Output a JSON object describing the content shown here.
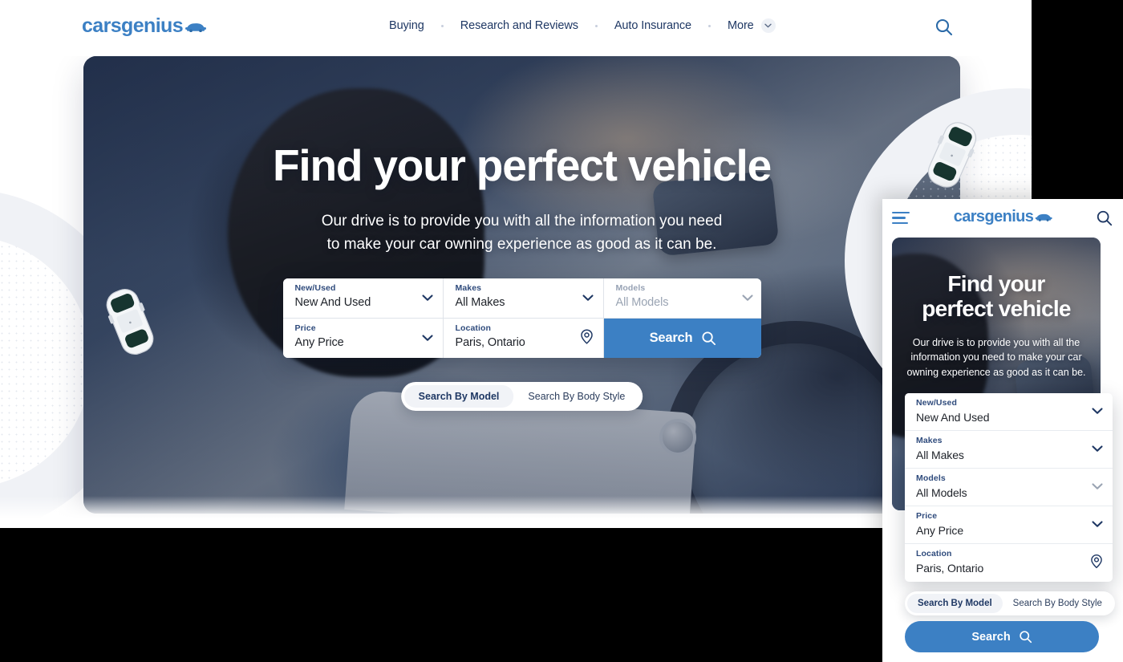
{
  "brand": {
    "name_part1": "cars",
    "name_part2": "genius",
    "logo_icon": "car-icon",
    "accent_color": "#3c80c4",
    "dark_color": "#1f3864"
  },
  "header": {
    "nav": [
      {
        "label": "Buying"
      },
      {
        "label": "Research and Reviews"
      },
      {
        "label": "Auto Insurance"
      },
      {
        "label": "More"
      }
    ],
    "more_chevron_icon": "chevron-down-icon",
    "search_icon": "search-icon"
  },
  "hero": {
    "title": "Find your perfect vehicle",
    "subtitle_line1": "Our drive is to provide you with all the information you need",
    "subtitle_line2": "to make your car owning experience as good as it can be."
  },
  "search_form": {
    "fields": [
      {
        "label": "New/Used",
        "value": "New And Used",
        "icon": "chevron-down-icon",
        "disabled": false
      },
      {
        "label": "Makes",
        "value": "All Makes",
        "icon": "chevron-down-icon",
        "disabled": false
      },
      {
        "label": "Models",
        "value": "All Models",
        "icon": "chevron-down-icon",
        "disabled": true
      },
      {
        "label": "Price",
        "value": "Any Price",
        "icon": "chevron-down-icon",
        "disabled": false
      },
      {
        "label": "Location",
        "value": "Paris, Ontario",
        "icon": "location-pin-icon",
        "disabled": false
      }
    ],
    "search_button_label": "Search",
    "search_button_icon": "search-icon",
    "search_button_color": "#3c80c4"
  },
  "toggle": {
    "option_model": "Search By Model",
    "option_body_style": "Search By Body Style",
    "active": "Search By Model"
  },
  "mobile": {
    "hamburger_icon": "hamburger-menu-icon",
    "search_icon": "search-icon",
    "hero_title_line1": "Find your",
    "hero_title_line2": "perfect vehicle",
    "hero_sub_line1": "Our drive is to provide you with all the",
    "hero_sub_line2": "information you need to make your car",
    "hero_sub_line3": "owning experience as good as it can be.",
    "fields": [
      {
        "label": "New/Used",
        "value": "New And Used",
        "icon": "chevron-down-icon",
        "disabled": false
      },
      {
        "label": "Makes",
        "value": "All Makes",
        "icon": "chevron-down-icon",
        "disabled": false
      },
      {
        "label": "Models",
        "value": "All Models",
        "icon": "chevron-down-icon",
        "disabled": true
      },
      {
        "label": "Price",
        "value": "Any Price",
        "icon": "chevron-down-icon",
        "disabled": false
      },
      {
        "label": "Location",
        "value": "Paris, Ontario",
        "icon": "location-pin-icon",
        "disabled": false
      }
    ],
    "toggle_model": "Search By Model",
    "toggle_body_style": "Search By Body Style",
    "search_button_label": "Search"
  },
  "decor": {
    "car_icon_left": "car-top-view-icon",
    "car_icon_right": "car-top-view-icon",
    "arc_color": "#f0f2f6"
  }
}
